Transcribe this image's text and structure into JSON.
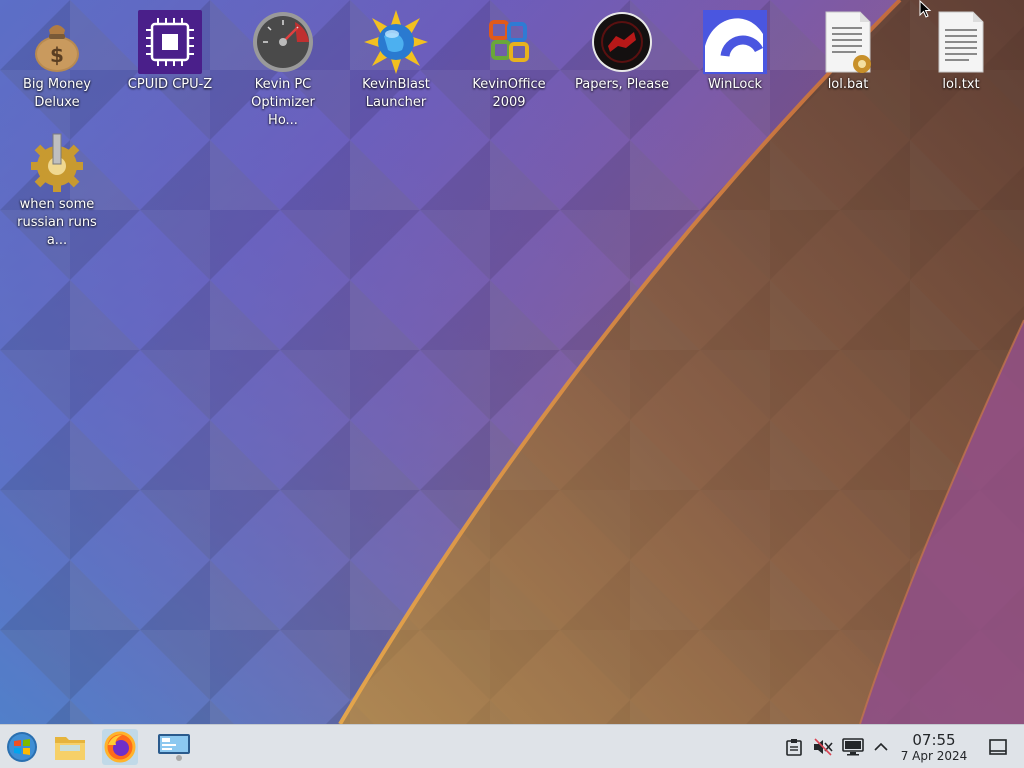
{
  "desktop": {
    "icons": [
      {
        "label": "Big Money\nDeluxe",
        "icon": "money-bag-icon"
      },
      {
        "label": "CPUID CPU-Z",
        "icon": "cpu-chip-icon"
      },
      {
        "label": "Kevin PC\nOptimizer Ho...",
        "icon": "speedometer-icon"
      },
      {
        "label": "KevinBlast\nLauncher",
        "icon": "globe-burst-icon"
      },
      {
        "label": "KevinOffice\n2009",
        "icon": "office-logo-icon"
      },
      {
        "label": "Papers, Please",
        "icon": "papers-please-seal-icon"
      },
      {
        "label": "WinLock",
        "icon": "padlock-arc-icon"
      },
      {
        "label": "lol.bat",
        "icon": "batch-file-icon"
      },
      {
        "label": "lol.txt",
        "icon": "text-file-icon"
      },
      {
        "label": "when some\nrussian runs a...",
        "icon": "gear-executable-icon"
      }
    ]
  },
  "taskbar": {
    "launchers": [
      {
        "name": "start-menu-button",
        "icon": "windows-orb-icon"
      },
      {
        "name": "file-manager-button",
        "icon": "folder-icon"
      },
      {
        "name": "firefox-button",
        "icon": "firefox-icon"
      },
      {
        "name": "system-settings-button",
        "icon": "monitor-settings-icon"
      }
    ],
    "tray": {
      "icons": [
        "clipboard-icon",
        "volume-muted-icon",
        "display-icon",
        "chevron-up-icon"
      ]
    },
    "clock": {
      "time": "07:55",
      "date": "7 Apr 2024"
    },
    "show_desktop_icon": "show-desktop-icon"
  },
  "colors": {
    "taskbar_bg": "#dfe3e8",
    "accent": "#3daee9"
  }
}
